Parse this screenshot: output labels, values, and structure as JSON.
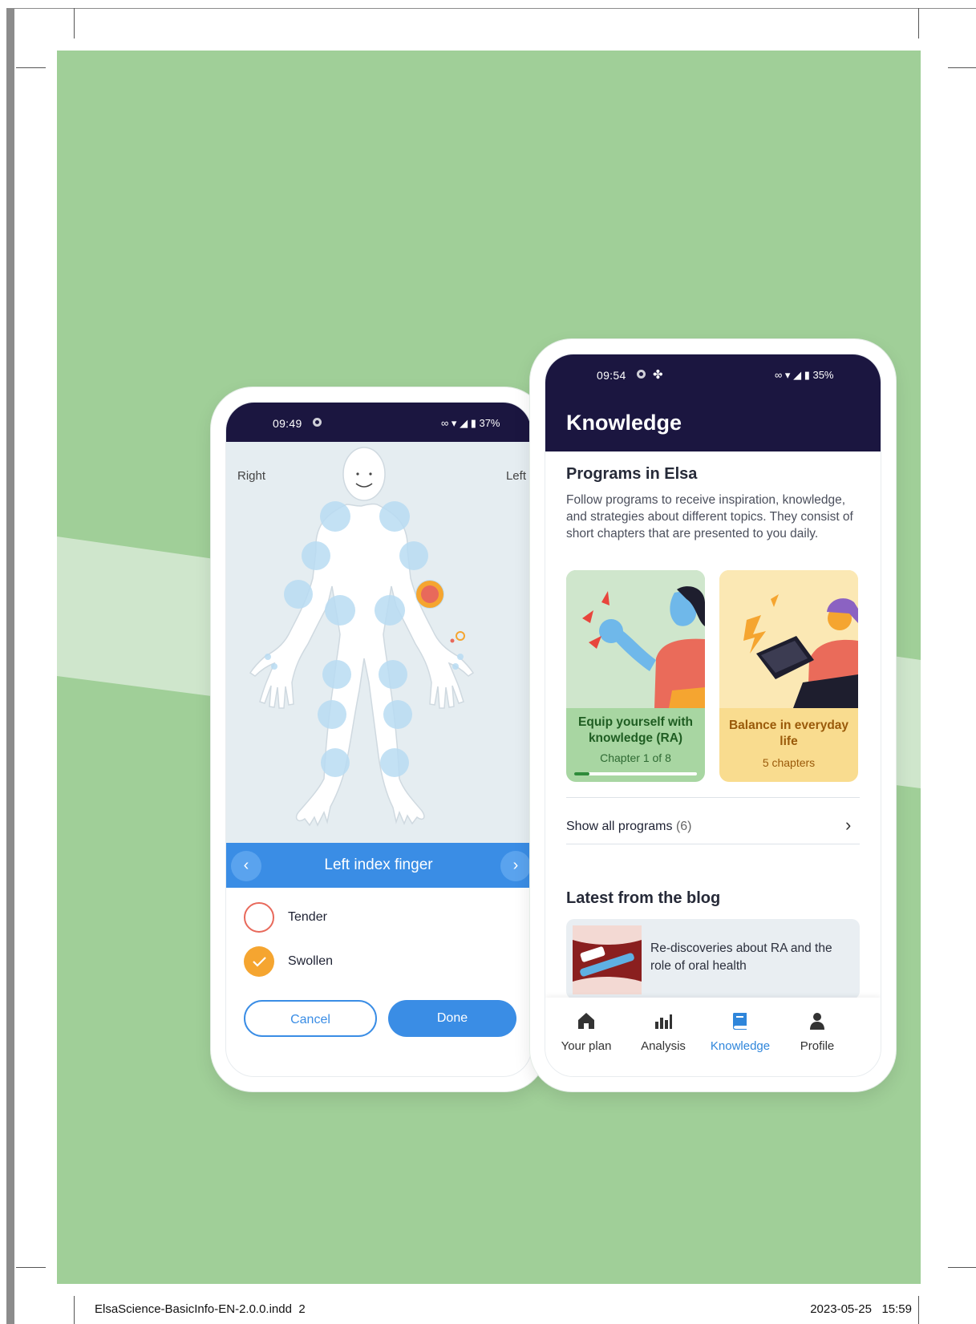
{
  "footer": {
    "filename": "ElsaScience-BasicInfo-EN-2.0.0.indd",
    "page": "2",
    "date": "2023-05-25",
    "time": "15:59"
  },
  "colors": {
    "background_green": "#a0cf98",
    "band_light": "#cfe6cc",
    "header_navy": "#1b1640",
    "primary_blue": "#3a8de5",
    "tender_red": "#e8695b",
    "swollen_orange": "#f5a530",
    "card_green": "#a8d6a2",
    "card_yellow": "#f9dc8f"
  },
  "phone1": {
    "status": {
      "time": "09:49",
      "battery": "37%"
    },
    "body_map": {
      "right_label": "Right",
      "left_label": "Left"
    },
    "selector": {
      "title": "Left index finger"
    },
    "options": [
      {
        "label": "Tender",
        "checked": false
      },
      {
        "label": "Swollen",
        "checked": true
      }
    ],
    "buttons": {
      "cancel": "Cancel",
      "done": "Done"
    }
  },
  "phone2": {
    "status": {
      "time": "09:54",
      "battery": "35%"
    },
    "title": "Knowledge",
    "programs": {
      "heading": "Programs in Elsa",
      "description": "Follow programs to receive inspiration, knowledge, and strategies about different topics. They consist of short chapters that are presented to you daily.",
      "cards": [
        {
          "title": "Equip yourself with knowledge (RA)",
          "subtitle": "Chapter 1 of 8",
          "progress": 0.125
        },
        {
          "title": "Balance in everyday life",
          "subtitle": "5 chapters"
        }
      ],
      "show_all_label": "Show all programs",
      "show_all_count": "(6)"
    },
    "blog": {
      "heading": "Latest from the blog",
      "article_title": "Re-discoveries about RA and the role of oral health"
    },
    "nav": [
      {
        "label": "Your plan",
        "icon": "home-icon",
        "active": false
      },
      {
        "label": "Analysis",
        "icon": "bar-chart-icon",
        "active": false
      },
      {
        "label": "Knowledge",
        "icon": "book-icon",
        "active": true
      },
      {
        "label": "Profile",
        "icon": "person-icon",
        "active": false
      }
    ]
  }
}
